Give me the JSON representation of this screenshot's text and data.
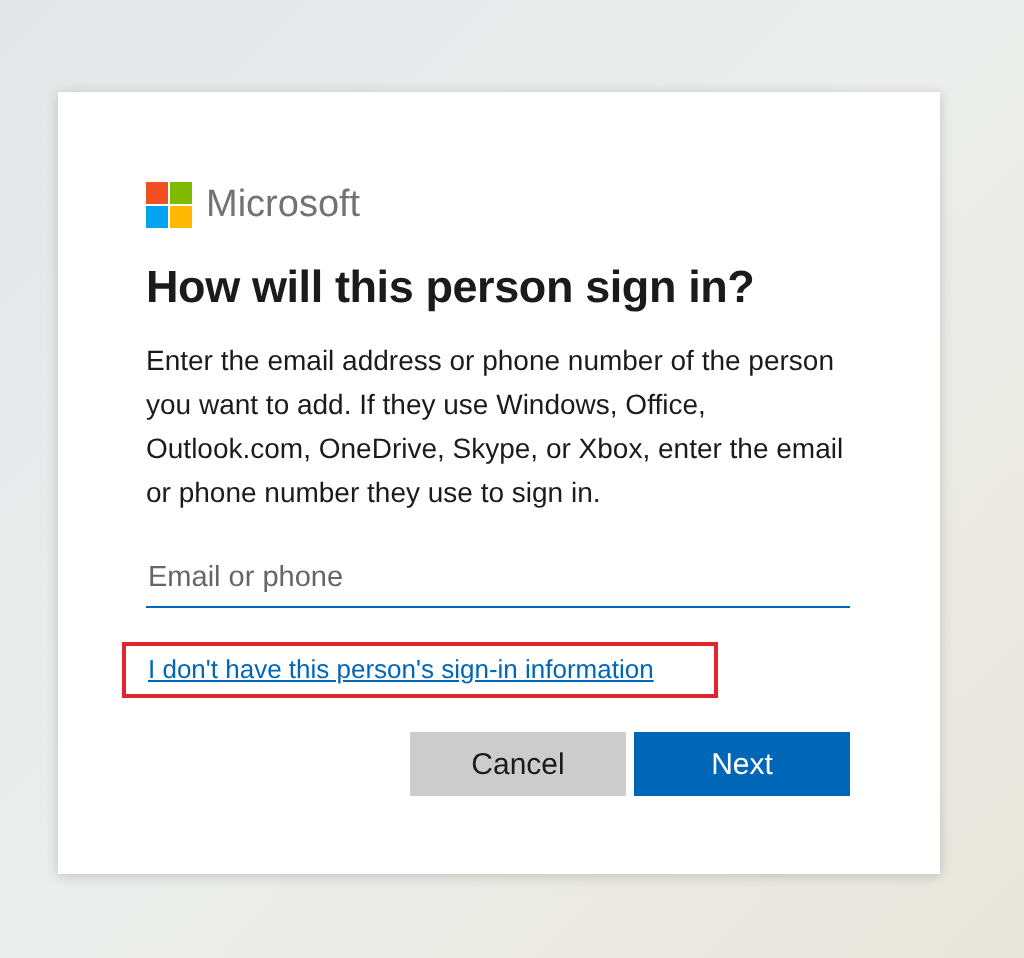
{
  "brand": {
    "name": "Microsoft"
  },
  "title": "How will this person sign in?",
  "description": "Enter the email address or phone number of the person you want to add. If they use Windows, Office, Outlook.com, OneDrive, Skype, or Xbox, enter the email or phone number they use to sign in.",
  "email_field": {
    "placeholder": "Email or phone"
  },
  "link": {
    "label": "I don't have this person's sign-in information",
    "highlighted": true
  },
  "buttons": [
    {
      "label": "Cancel",
      "kind": "secondary"
    },
    {
      "label": "Next",
      "kind": "primary"
    }
  ]
}
